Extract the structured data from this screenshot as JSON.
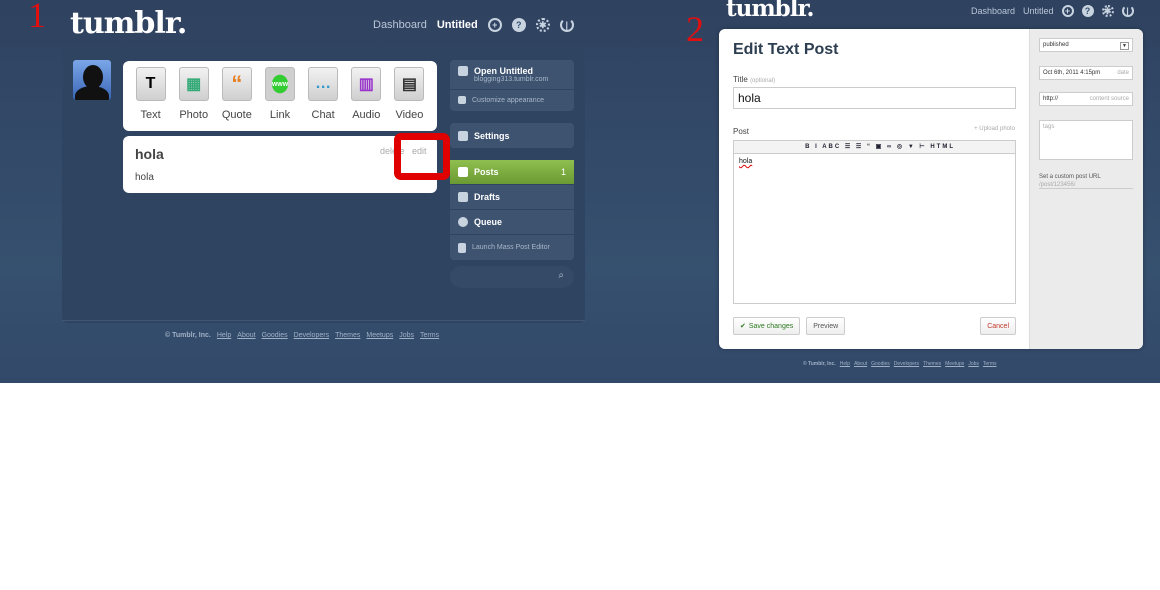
{
  "panel1": {
    "step": "1",
    "logo": "tumblr.",
    "nav": {
      "dashboard": "Dashboard",
      "blog": "Untitled"
    },
    "post_types": [
      "Text",
      "Photo",
      "Quote",
      "Link",
      "Chat",
      "Audio",
      "Video"
    ],
    "post_type_glyphs": [
      "T",
      "▦",
      "“",
      "www",
      "…",
      "▥",
      "▤"
    ],
    "post": {
      "title": "hola",
      "body": "hola",
      "delete": "delete",
      "edit": "edit"
    },
    "sidebar": {
      "open_blog": "Open Untitled",
      "blog_url": "blogging313.tumblr.com",
      "customize": "Customize appearance",
      "settings": "Settings",
      "posts": "Posts",
      "posts_count": "1",
      "drafts": "Drafts",
      "queue": "Queue",
      "mass_editor": "Launch Mass Post Editor"
    },
    "footer": {
      "copyright": "© Tumblr, Inc.",
      "links": [
        "Help",
        "About",
        "Goodies",
        "Developers",
        "Themes",
        "Meetups",
        "Jobs",
        "Terms"
      ]
    }
  },
  "panel2": {
    "step": "2",
    "logo": "tumblr.",
    "nav": {
      "dashboard": "Dashboard",
      "blog": "Untitled"
    },
    "editor": {
      "heading": "Edit Text Post",
      "title_label": "Title",
      "title_optional": "(optional)",
      "title_value": "hola",
      "post_label": "Post",
      "upload_photo": "+ Upload photo",
      "toolbar": "B I ABC ☰ ☰ “ ▣ ∞ ◎ ▼ ⊢ HTML",
      "post_body": "hola",
      "save": "Save changes",
      "preview": "Preview",
      "cancel": "Cancel"
    },
    "side": {
      "status": "published",
      "date_value": "Oct 6th, 2011 4:15pm",
      "date_hint": "date",
      "source_value": "http://",
      "source_hint": "content source",
      "tags_placeholder": "tags",
      "custom_url": "Set a custom post URL",
      "custom_url_placeholder": "/post/123456/"
    },
    "footer": {
      "copyright": "© Tumblr, Inc.",
      "links": [
        "Help",
        "About",
        "Goodies",
        "Developers",
        "Themes",
        "Meetups",
        "Jobs",
        "Terms"
      ]
    }
  },
  "colors": {
    "background": "#36506f",
    "accent_green": "#7aac3f",
    "highlight_red": "#e00000"
  }
}
